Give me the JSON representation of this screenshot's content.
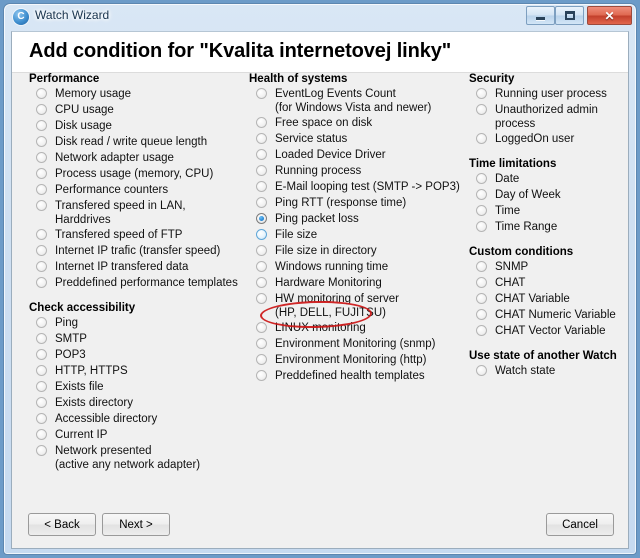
{
  "window": {
    "title": "Watch Wizard",
    "icon": "app-circle-icon",
    "icon_glyph": "C",
    "caption_buttons": {
      "minimize": "Minimize",
      "maximize": "Maximize",
      "close": "Close",
      "close_glyph": "✕"
    }
  },
  "page": {
    "title": "Add condition for \"Kvalita internetovej linky\""
  },
  "columns": {
    "left": [
      {
        "title": "Performance",
        "options": [
          {
            "label": "Memory usage",
            "state": "normal"
          },
          {
            "label": "CPU usage",
            "state": "normal"
          },
          {
            "label": "Disk usage",
            "state": "normal"
          },
          {
            "label": "Disk read / write queue length",
            "state": "normal"
          },
          {
            "label": "Network adapter usage",
            "state": "normal"
          },
          {
            "label": "Process usage (memory, CPU)",
            "state": "normal"
          },
          {
            "label": "Performance counters",
            "state": "normal"
          },
          {
            "label": "Transfered speed in LAN,\nHarddrives",
            "state": "normal"
          },
          {
            "label": "Transfered speed of FTP",
            "state": "normal"
          },
          {
            "label": "Internet IP trafic (transfer speed)",
            "state": "normal"
          },
          {
            "label": "Internet IP transfered data",
            "state": "normal"
          },
          {
            "label": "Preddefined performance templates",
            "state": "normal"
          }
        ]
      },
      {
        "title": "Check accessibility",
        "options": [
          {
            "label": "Ping",
            "state": "normal"
          },
          {
            "label": "SMTP",
            "state": "normal"
          },
          {
            "label": "POP3",
            "state": "normal"
          },
          {
            "label": "HTTP, HTTPS",
            "state": "normal"
          },
          {
            "label": "Exists file",
            "state": "normal"
          },
          {
            "label": "Exists directory",
            "state": "normal"
          },
          {
            "label": "Accessible directory",
            "state": "normal"
          },
          {
            "label": "Current IP",
            "state": "normal"
          },
          {
            "label": "Network presented\n(active any network adapter)",
            "state": "normal"
          }
        ]
      }
    ],
    "mid": [
      {
        "title": "Health of systems",
        "options": [
          {
            "label": "EventLog Events Count\n(for Windows Vista and newer)",
            "state": "normal"
          },
          {
            "label": "Free space on disk",
            "state": "normal"
          },
          {
            "label": "Service status",
            "state": "normal"
          },
          {
            "label": "Loaded Device Driver",
            "state": "normal"
          },
          {
            "label": "Running process",
            "state": "normal"
          },
          {
            "label": "E-Mail looping test (SMTP -> POP3)",
            "state": "normal"
          },
          {
            "label": "Ping RTT (response time)",
            "state": "normal"
          },
          {
            "label": "Ping packet loss",
            "state": "checked"
          },
          {
            "label": "File size",
            "state": "hover"
          },
          {
            "label": "File size in directory",
            "state": "normal"
          },
          {
            "label": "Windows running time",
            "state": "normal"
          },
          {
            "label": "Hardware Monitoring",
            "state": "normal"
          },
          {
            "label": "HW monitoring of server\n(HP, DELL, FUJITSU)",
            "state": "normal"
          },
          {
            "label": "LINUX monitoring",
            "state": "normal"
          },
          {
            "label": "Environment Monitoring (snmp)",
            "state": "normal"
          },
          {
            "label": "Environment Monitoring (http)",
            "state": "normal"
          },
          {
            "label": "Preddefined health templates",
            "state": "normal"
          }
        ]
      }
    ],
    "right": [
      {
        "title": "Security",
        "options": [
          {
            "label": "Running user process",
            "state": "normal"
          },
          {
            "label": "Unauthorized admin process",
            "state": "normal"
          },
          {
            "label": "LoggedOn user",
            "state": "normal"
          }
        ]
      },
      {
        "title": "Time limitations",
        "options": [
          {
            "label": "Date",
            "state": "normal"
          },
          {
            "label": "Day of Week",
            "state": "normal"
          },
          {
            "label": "Time",
            "state": "normal"
          },
          {
            "label": "Time Range",
            "state": "normal"
          }
        ]
      },
      {
        "title": "Custom conditions",
        "options": [
          {
            "label": "SNMP",
            "state": "normal"
          },
          {
            "label": "CHAT",
            "state": "normal"
          },
          {
            "label": "CHAT Variable",
            "state": "normal"
          },
          {
            "label": "CHAT Numeric Variable",
            "state": "normal"
          },
          {
            "label": "CHAT Vector Variable",
            "state": "normal"
          }
        ]
      },
      {
        "title": "Use state of another Watch",
        "options": [
          {
            "label": "Watch state",
            "state": "normal"
          }
        ]
      }
    ]
  },
  "footer": {
    "back": "< Back",
    "next": "Next >",
    "cancel": "Cancel"
  },
  "annotation": {
    "type": "red-ellipse-highlight",
    "target": "Ping packet loss",
    "color": "#cc1616"
  }
}
